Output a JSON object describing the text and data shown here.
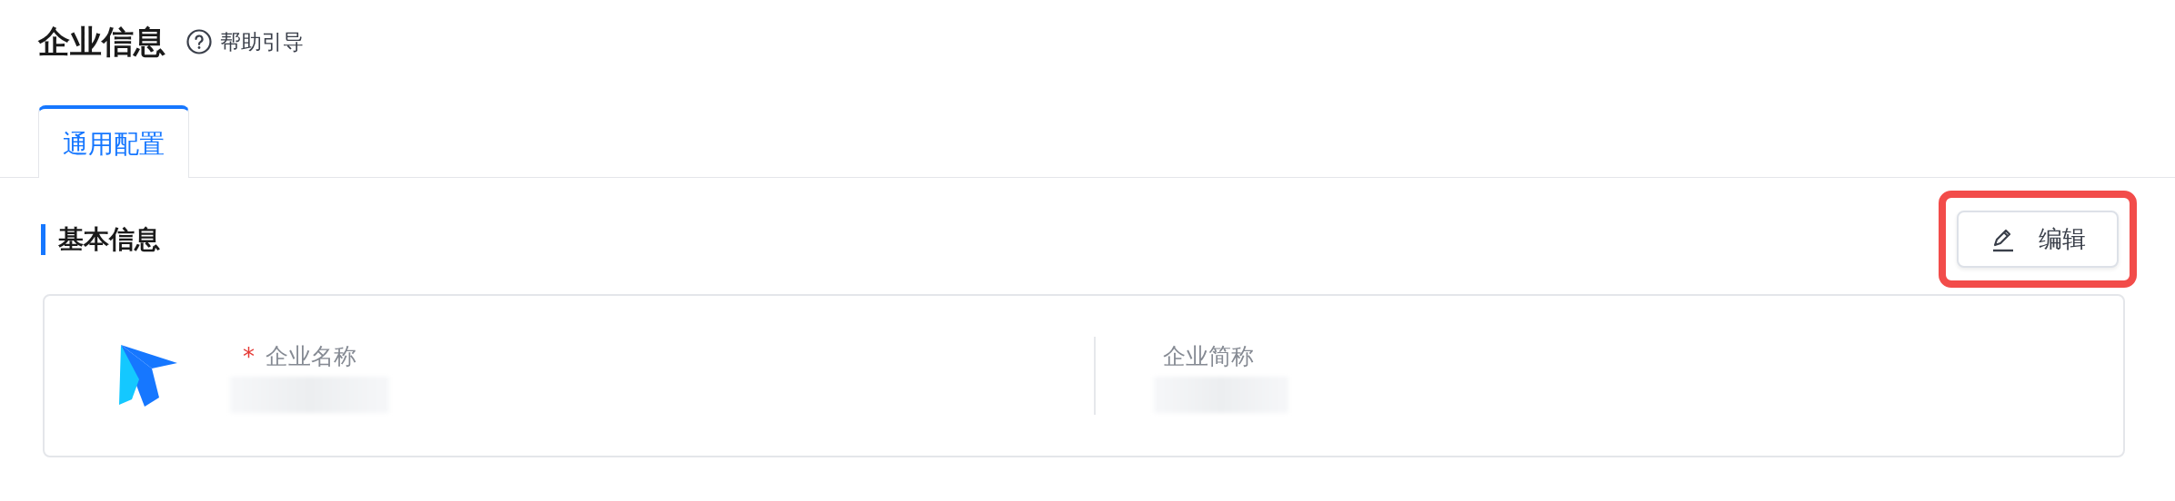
{
  "header": {
    "title": "企业信息",
    "help_link": "帮助引导"
  },
  "tabs": [
    {
      "label": "通用配置",
      "selected": true
    }
  ],
  "section": {
    "title": "基本信息",
    "edit_button": {
      "label": "编辑",
      "highlighted": true
    }
  },
  "card": {
    "fields": [
      {
        "label": "企业名称",
        "required": true,
        "required_mark": "*",
        "redacted": true
      },
      {
        "label": "企业简称",
        "required": false,
        "redacted": true
      }
    ]
  }
}
